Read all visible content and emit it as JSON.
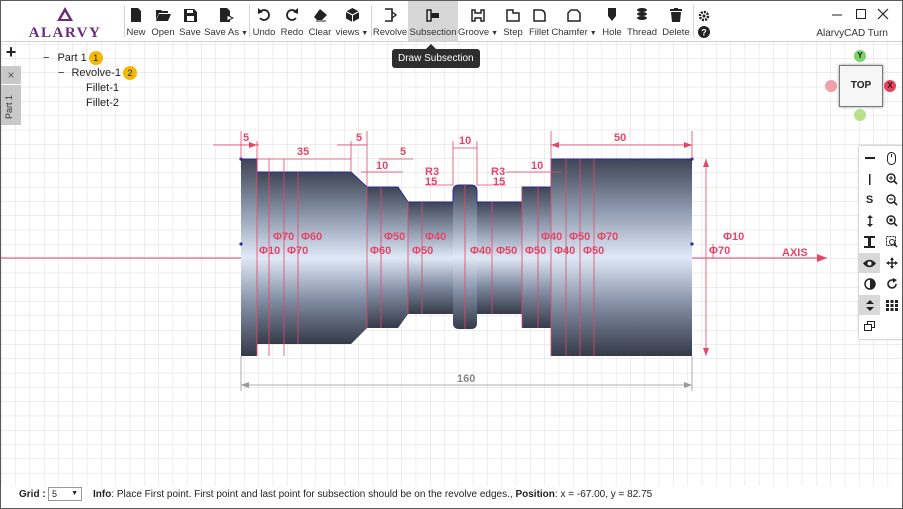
{
  "app": {
    "title": "AlarvyCAD Turn",
    "logo_text": "ALARVY"
  },
  "toolbar": {
    "new": "New",
    "open": "Open",
    "save": "Save",
    "save_as": "Save As",
    "undo": "Undo",
    "redo": "Redo",
    "clear": "Clear",
    "views": "views",
    "revolve": "Revolve",
    "subsection": "Subsection",
    "groove": "Groove",
    "step": "Step",
    "fillet": "Fillet",
    "chamfer": "Chamfer",
    "hole": "Hole",
    "thread": "Thread",
    "delete": "Delete"
  },
  "tooltip": "Draw Subsection",
  "left_panel": {
    "add": "+",
    "close": "×",
    "tab_label": "Part 1"
  },
  "tree": [
    {
      "label": "Part 1",
      "badge": "1",
      "toggle": "−"
    },
    {
      "label": "Revolve-1",
      "badge": "2",
      "toggle": "−"
    },
    {
      "label": "Fillet-1"
    },
    {
      "label": "Fillet-2"
    }
  ],
  "view_cube": {
    "face": "TOP",
    "y": "Y",
    "x": "X"
  },
  "right_tools": [
    "minus",
    "mouse",
    "line",
    "zoom-in",
    "S",
    "zoom-out",
    "move-vertical",
    "zoom-fit",
    "I-beam",
    "zoom-window",
    "eye",
    "pan",
    "contrast",
    "rotate",
    "updown",
    "grid",
    "layers"
  ],
  "drawing": {
    "axis_label": "AXIS",
    "dims_top": [
      "5",
      "35",
      "5",
      "5",
      "10",
      "10",
      "10",
      "50"
    ],
    "radius_labels": [
      "R3",
      "R3"
    ],
    "small_dims": [
      "15",
      "15"
    ],
    "diameters": [
      "Φ70",
      "Φ60",
      "Φ10",
      "Φ70",
      "Φ60",
      "Φ50",
      "Φ40",
      "Φ50",
      "Φ40",
      "Φ50",
      "Φ40",
      "Φ50",
      "Φ70",
      "Φ50",
      "Φ40",
      "Φ50",
      "Φ10",
      "Φ70"
    ],
    "overall_length": "160"
  },
  "status": {
    "grid_label": "Grid :",
    "grid_value": "5",
    "info_label": "Info",
    "info_text": ": Place First point. First point and last point for subsection should be on the revolve edges.,",
    "position_label": "Position",
    "position_text": ": x = -67.00, y = 82.75"
  }
}
